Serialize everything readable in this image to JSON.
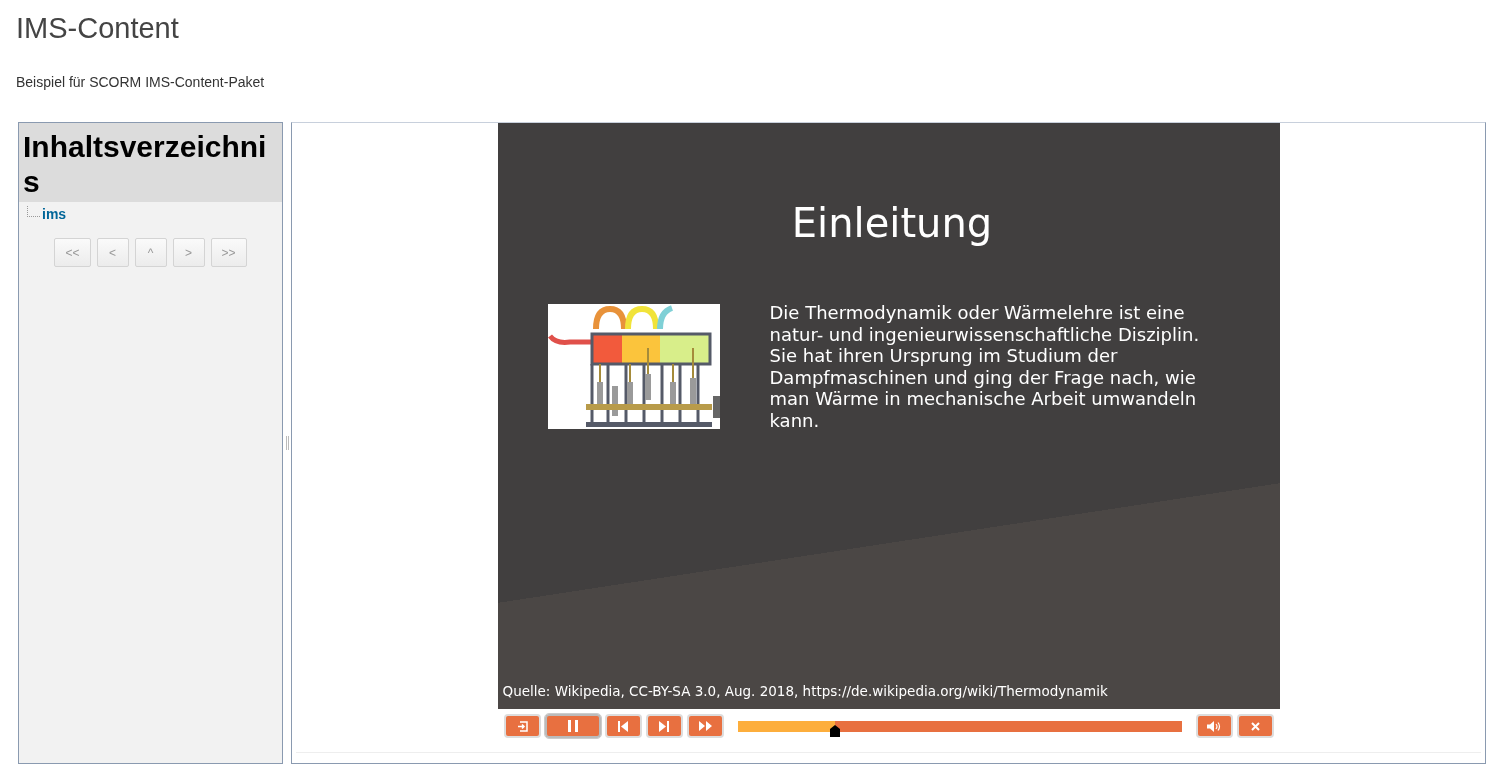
{
  "page": {
    "title": "IMS-Content",
    "subtitle": "Beispiel für SCORM IMS-Content-Paket"
  },
  "toc": {
    "heading": "Inhaltsverzeichnis",
    "items": [
      {
        "label": "ims"
      }
    ],
    "nav_buttons": [
      "<<",
      "<",
      "^",
      ">",
      ">>"
    ]
  },
  "slide": {
    "title": "Einleitung",
    "body": "Die Thermodynamik oder Wärmelehre ist eine natur- und ingenieurwissenschaftliche Disziplin. Sie hat ihren Ursprung im Studium der Dampfmaschinen und ging der Frage nach, wie man Wärme in mechanische Arbeit umwandeln kann.",
    "source": "Quelle: Wikipedia, CC-BY-SA 3.0, Aug. 2018, https://de.wikipedia.org/wiki/Thermodynamik"
  },
  "player": {
    "playing": true,
    "progress": {
      "level": 0.22
    }
  }
}
